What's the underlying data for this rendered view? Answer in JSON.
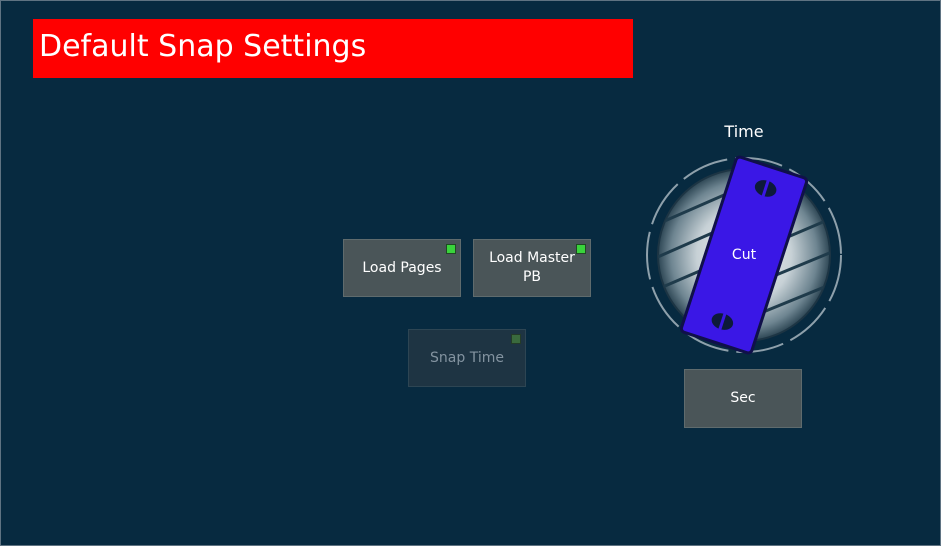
{
  "header": {
    "title": "Default Snap Settings",
    "background_color": "#ff0000"
  },
  "buttons": {
    "load_pages": {
      "label": "Load Pages",
      "indicator": "on"
    },
    "load_master_pb": {
      "label": "Load Master PB",
      "indicator": "on"
    },
    "snap_time": {
      "label": "Snap Time",
      "indicator": "off",
      "state": "disabled"
    },
    "sec": {
      "label": "Sec"
    }
  },
  "dial": {
    "title": "Time",
    "value_label": "Cut",
    "accent_color": "#3a17e6"
  },
  "colors": {
    "background": "#072a40",
    "button": "#4a5558",
    "indicator_on": "#39d33c"
  }
}
